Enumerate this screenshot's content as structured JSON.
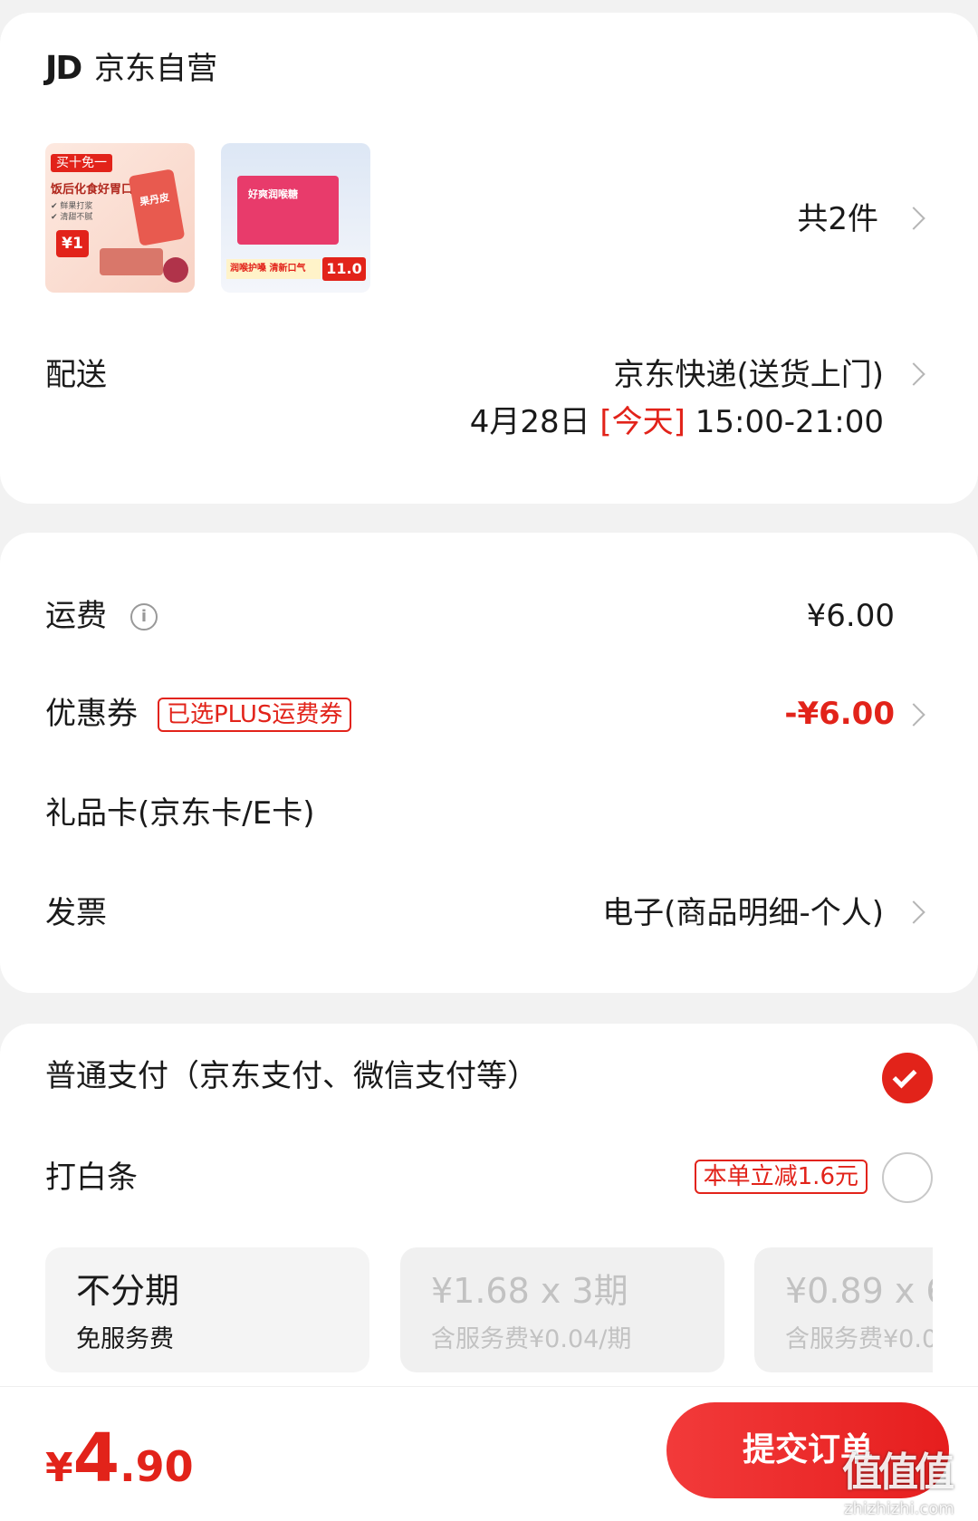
{
  "shop": {
    "logo": "JD",
    "name": "京东自营"
  },
  "products": {
    "count_label": "共2件",
    "item1": {
      "badge": "买十免一",
      "headline": "饭后化食好胃口",
      "bullets": [
        "✔ 鲜果打浆",
        "✔ 清甜不腻"
      ],
      "price_tag": "¥1",
      "bag_text": "果丹皮"
    },
    "item2": {
      "headline": "好爽润喉糖",
      "banner": "润喉护嗓 清新口气",
      "price": "11.0"
    }
  },
  "delivery": {
    "label": "配送",
    "method": "京东快递(送货上门)",
    "date": "4月28日",
    "today": "[今天]",
    "window": "15:00-21:00"
  },
  "fees": {
    "shipping_label": "运费",
    "shipping_value": "¥6.00",
    "coupon_label": "优惠券",
    "coupon_tag": "已选PLUS运费券",
    "coupon_value": "-¥6.00",
    "giftcard_label": "礼品卡(京东卡/E卡)",
    "invoice_label": "发票",
    "invoice_value": "电子(商品明细-个人)"
  },
  "payment": {
    "normal_label": "普通支付（京东支付、微信支付等）",
    "baitiao_label": "打白条",
    "baitiao_tag": "本单立减1.6元",
    "installments": [
      {
        "title": "不分期",
        "sub": "免服务费"
      },
      {
        "title": "¥1.68 x 3期",
        "sub": "含服务费¥0.04/期"
      },
      {
        "title": "¥0.89 x 6",
        "sub": "含服务费¥0.0"
      }
    ]
  },
  "footer": {
    "currency": "¥",
    "integer": "4",
    "decimal": ".90",
    "submit_label": "提交订单"
  },
  "watermark": {
    "logo": "值值值",
    "site": "zhizhizhi.com"
  },
  "colors": {
    "accent": "#e2231a",
    "background": "#f2f2f2"
  }
}
